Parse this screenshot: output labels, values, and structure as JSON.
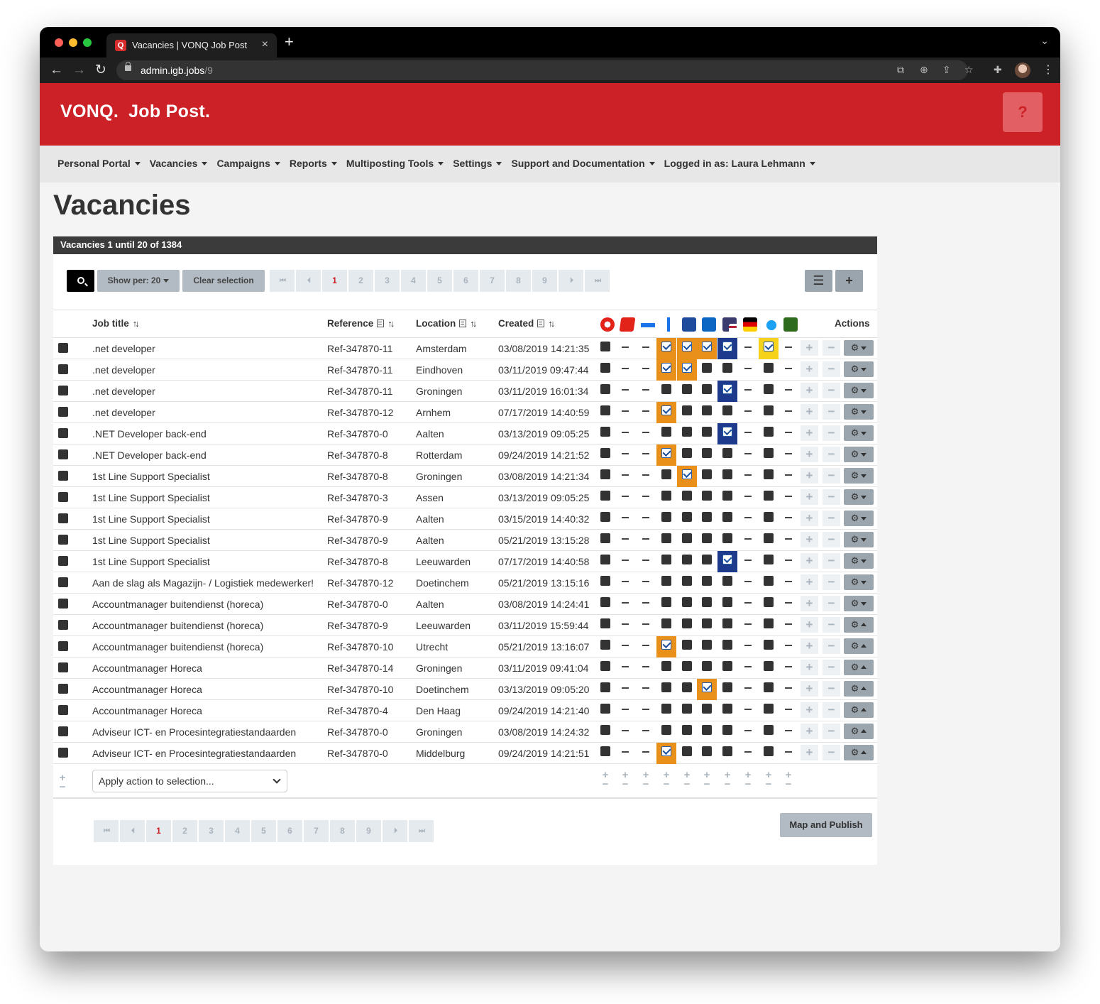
{
  "browser": {
    "tab_title": "Vacancies | VONQ Job Post",
    "favicon": "Q",
    "url_host": "admin.igb.jobs",
    "url_path": "/9"
  },
  "brand": {
    "logo_left": "VONQ.",
    "logo_right": "Job Post.",
    "help": "?",
    "color": "#cc2127"
  },
  "menu": [
    "Personal Portal",
    "Vacancies",
    "Campaigns",
    "Reports",
    "Multiposting Tools",
    "Settings",
    "Support and Documentation",
    "Logged in as: Laura Lehmann"
  ],
  "page_title": "Vacancies",
  "panel_header": "Vacancies 1 until 20 of 1384",
  "toolbar": {
    "show_per": "Show per: 20",
    "clear_selection": "Clear selection"
  },
  "pager": [
    "1",
    "2",
    "3",
    "4",
    "5",
    "6",
    "7",
    "8",
    "9"
  ],
  "pager_active": "1",
  "pager_nav": {
    "first": "⏮",
    "prev": "⏴",
    "next": "⏵",
    "last": "⏭"
  },
  "columns": {
    "job_title": "Job title",
    "reference": "Reference",
    "location": "Location",
    "created": "Created",
    "actions": "Actions"
  },
  "sort_icon": "↑↓",
  "portal_icons": [
    "arbeitsagentur-icon",
    "portal-red-icon",
    "portal-blue-dots-icon",
    "indeed-icon",
    "monsterboard-icon",
    "linkedin-icon",
    "us-flag-icon",
    "germany-flag-icon",
    "twitter-icon",
    "jobboard-green-icon"
  ],
  "rows": [
    {
      "title": ".net developer",
      "ref": "Ref-347870-11",
      "loc": "Amsterdam",
      "created": "03/08/2019 14:21:35",
      "s": [
        "b",
        "-",
        "-",
        "o",
        "o",
        "o",
        "n",
        "-",
        "y",
        "-"
      ],
      "gear": "down"
    },
    {
      "title": ".net developer",
      "ref": "Ref-347870-11",
      "loc": "Eindhoven",
      "created": "03/11/2019 09:47:44",
      "s": [
        "b",
        "-",
        "-",
        "o",
        "o",
        "b",
        "b",
        "-",
        "b",
        "-"
      ],
      "gear": "down"
    },
    {
      "title": ".net developer",
      "ref": "Ref-347870-11",
      "loc": "Groningen",
      "created": "03/11/2019 16:01:34",
      "s": [
        "b",
        "-",
        "-",
        "b",
        "b",
        "b",
        "n",
        "-",
        "b",
        "-"
      ],
      "gear": "down"
    },
    {
      "title": ".net developer",
      "ref": "Ref-347870-12",
      "loc": "Arnhem",
      "created": "07/17/2019 14:40:59",
      "s": [
        "b",
        "-",
        "-",
        "o",
        "b",
        "b",
        "b",
        "-",
        "b",
        "-"
      ],
      "gear": "down"
    },
    {
      "title": ".NET Developer back-end",
      "ref": "Ref-347870-0",
      "loc": "Aalten",
      "created": "03/13/2019 09:05:25",
      "s": [
        "b",
        "-",
        "-",
        "b",
        "b",
        "b",
        "n",
        "-",
        "b",
        "-"
      ],
      "gear": "down"
    },
    {
      "title": ".NET Developer back-end",
      "ref": "Ref-347870-8",
      "loc": "Rotterdam",
      "created": "09/24/2019 14:21:52",
      "s": [
        "b",
        "-",
        "-",
        "o",
        "b",
        "b",
        "b",
        "-",
        "b",
        "-"
      ],
      "gear": "down"
    },
    {
      "title": "1st Line Support Specialist",
      "ref": "Ref-347870-8",
      "loc": "Groningen",
      "created": "03/08/2019 14:21:34",
      "s": [
        "b",
        "-",
        "-",
        "b",
        "o",
        "b",
        "b",
        "-",
        "b",
        "-"
      ],
      "gear": "down"
    },
    {
      "title": "1st Line Support Specialist",
      "ref": "Ref-347870-3",
      "loc": "Assen",
      "created": "03/13/2019 09:05:25",
      "s": [
        "b",
        "-",
        "-",
        "b",
        "b",
        "b",
        "b",
        "-",
        "b",
        "-"
      ],
      "gear": "down"
    },
    {
      "title": "1st Line Support Specialist",
      "ref": "Ref-347870-9",
      "loc": "Aalten",
      "created": "03/15/2019 14:40:32",
      "s": [
        "b",
        "-",
        "-",
        "b",
        "b",
        "b",
        "b",
        "-",
        "b",
        "-"
      ],
      "gear": "down"
    },
    {
      "title": "1st Line Support Specialist",
      "ref": "Ref-347870-9",
      "loc": "Aalten",
      "created": "05/21/2019 13:15:28",
      "s": [
        "b",
        "-",
        "-",
        "b",
        "b",
        "b",
        "b",
        "-",
        "b",
        "-"
      ],
      "gear": "down"
    },
    {
      "title": "1st Line Support Specialist",
      "ref": "Ref-347870-8",
      "loc": "Leeuwarden",
      "created": "07/17/2019 14:40:58",
      "s": [
        "b",
        "-",
        "-",
        "b",
        "b",
        "b",
        "n",
        "-",
        "b",
        "-"
      ],
      "gear": "down"
    },
    {
      "title": "Aan de slag als Magazijn- / Logistiek medewerker!",
      "ref": "Ref-347870-12",
      "loc": "Doetinchem",
      "created": "05/21/2019 13:15:16",
      "s": [
        "b",
        "-",
        "-",
        "b",
        "b",
        "b",
        "b",
        "-",
        "b",
        "-"
      ],
      "gear": "down"
    },
    {
      "title": "Accountmanager buitendienst (horeca)",
      "ref": "Ref-347870-0",
      "loc": "Aalten",
      "created": "03/08/2019 14:24:41",
      "s": [
        "b",
        "-",
        "-",
        "b",
        "b",
        "b",
        "b",
        "-",
        "b",
        "-"
      ],
      "gear": "down"
    },
    {
      "title": "Accountmanager buitendienst (horeca)",
      "ref": "Ref-347870-9",
      "loc": "Leeuwarden",
      "created": "03/11/2019 15:59:44",
      "s": [
        "b",
        "-",
        "-",
        "b",
        "b",
        "b",
        "b",
        "-",
        "b",
        "-"
      ],
      "gear": "up"
    },
    {
      "title": "Accountmanager buitendienst (horeca)",
      "ref": "Ref-347870-10",
      "loc": "Utrecht",
      "created": "05/21/2019 13:16:07",
      "s": [
        "b",
        "-",
        "-",
        "o",
        "b",
        "b",
        "b",
        "-",
        "b",
        "-"
      ],
      "gear": "up"
    },
    {
      "title": "Accountmanager Horeca",
      "ref": "Ref-347870-14",
      "loc": "Groningen",
      "created": "03/11/2019 09:41:04",
      "s": [
        "b",
        "-",
        "-",
        "b",
        "b",
        "b",
        "b",
        "-",
        "b",
        "-"
      ],
      "gear": "up"
    },
    {
      "title": "Accountmanager Horeca",
      "ref": "Ref-347870-10",
      "loc": "Doetinchem",
      "created": "03/13/2019 09:05:20",
      "s": [
        "b",
        "-",
        "-",
        "b",
        "b",
        "o",
        "b",
        "-",
        "b",
        "-"
      ],
      "gear": "up"
    },
    {
      "title": "Accountmanager Horeca",
      "ref": "Ref-347870-4",
      "loc": "Den Haag",
      "created": "09/24/2019 14:21:40",
      "s": [
        "b",
        "-",
        "-",
        "b",
        "b",
        "b",
        "b",
        "-",
        "b",
        "-"
      ],
      "gear": "up"
    },
    {
      "title": "Adviseur ICT- en Procesintegratiestandaarden",
      "ref": "Ref-347870-0",
      "loc": "Groningen",
      "created": "03/08/2019 14:24:32",
      "s": [
        "b",
        "-",
        "-",
        "b",
        "b",
        "b",
        "b",
        "-",
        "b",
        "-"
      ],
      "gear": "up"
    },
    {
      "title": "Adviseur ICT- en Procesintegratiestandaarden",
      "ref": "Ref-347870-0",
      "loc": "Middelburg",
      "created": "09/24/2019 14:21:51",
      "s": [
        "b",
        "-",
        "-",
        "o",
        "b",
        "b",
        "b",
        "-",
        "b",
        "-"
      ],
      "gear": "up"
    }
  ],
  "apply_placeholder": "Apply action to selection...",
  "map_publish": "Map and Publish",
  "colors": {
    "orange": "#e8901a",
    "navy": "#1d3a8c",
    "yellow": "#f6d21a"
  }
}
